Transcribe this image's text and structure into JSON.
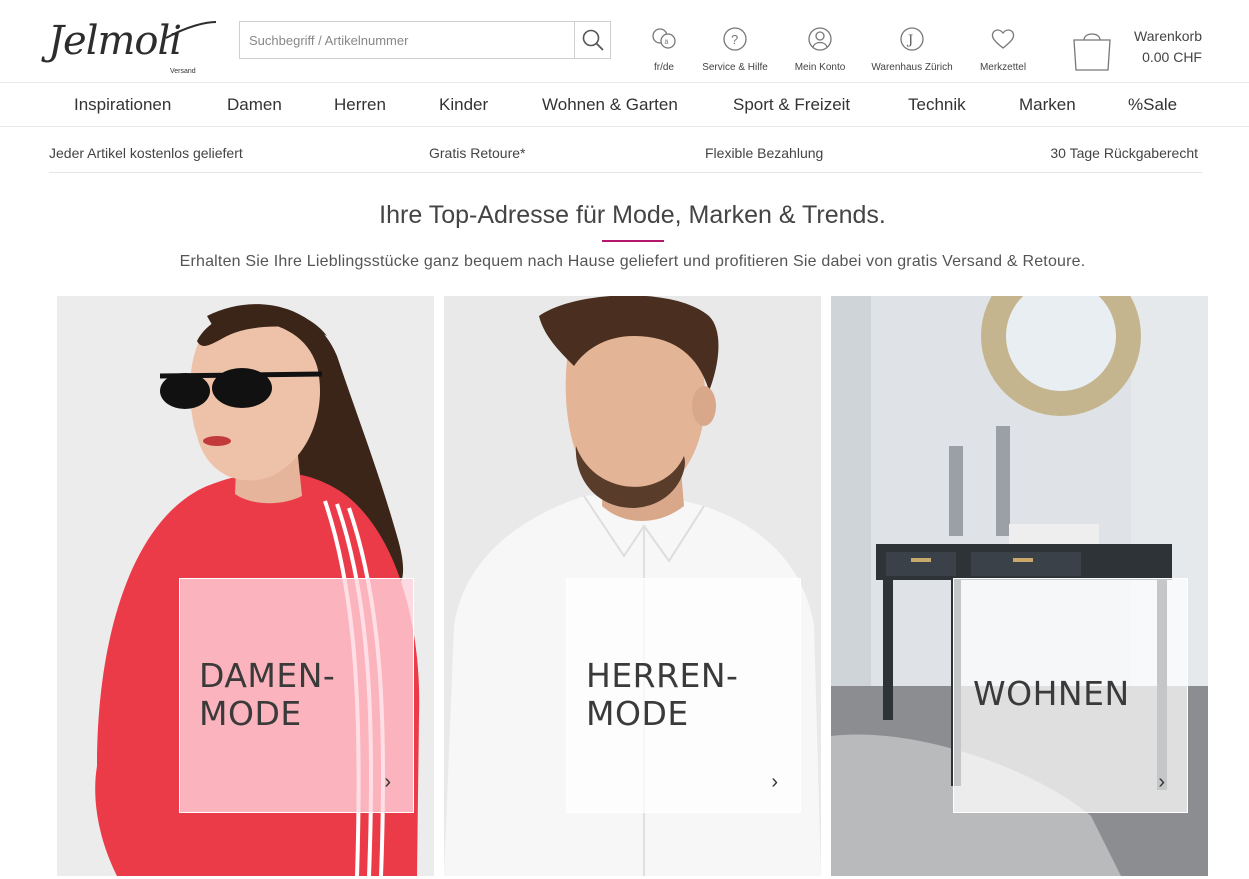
{
  "logo": {
    "text": "Jelmoli",
    "sub": "Versand"
  },
  "search": {
    "placeholder": "Suchbegriff / Artikelnummer"
  },
  "header_icons": [
    {
      "name": "language",
      "label": "fr/de",
      "icon": "language-icon"
    },
    {
      "name": "service",
      "label": "Service & Hilfe",
      "icon": "help-icon"
    },
    {
      "name": "account",
      "label": "Mein Konto",
      "icon": "user-icon"
    },
    {
      "name": "store",
      "label": "Warenhaus Zürich",
      "icon": "store-icon"
    },
    {
      "name": "wishlist",
      "label": "Merkzettel",
      "icon": "heart-icon"
    }
  ],
  "cart": {
    "label": "Warenkorb",
    "total": "0.00 CHF"
  },
  "nav": [
    "Inspirationen",
    "Damen",
    "Herren",
    "Kinder",
    "Wohnen & Garten",
    "Sport & Freizeit",
    "Technik",
    "Marken",
    "%Sale"
  ],
  "usp": [
    "Jeder Artikel kostenlos geliefert",
    "Gratis Retoure*",
    "Flexible Bezahlung",
    "30 Tage Rückgaberecht"
  ],
  "hero": {
    "title": "Ihre Top-Adresse für Mode, Marken & Trends.",
    "subtitle": "Erhalten Sie Ihre Lieblingsstücke ganz bequem nach Hause geliefert und profitieren Sie dabei von gratis Versand & Retoure."
  },
  "tiles": [
    {
      "label": "DAMEN-\nMODE",
      "arrow": "›"
    },
    {
      "label": "HERREN-\nMODE",
      "arrow": "›"
    },
    {
      "label": "WOHNEN",
      "arrow": "›"
    }
  ],
  "colors": {
    "accent": "#b5176f"
  }
}
